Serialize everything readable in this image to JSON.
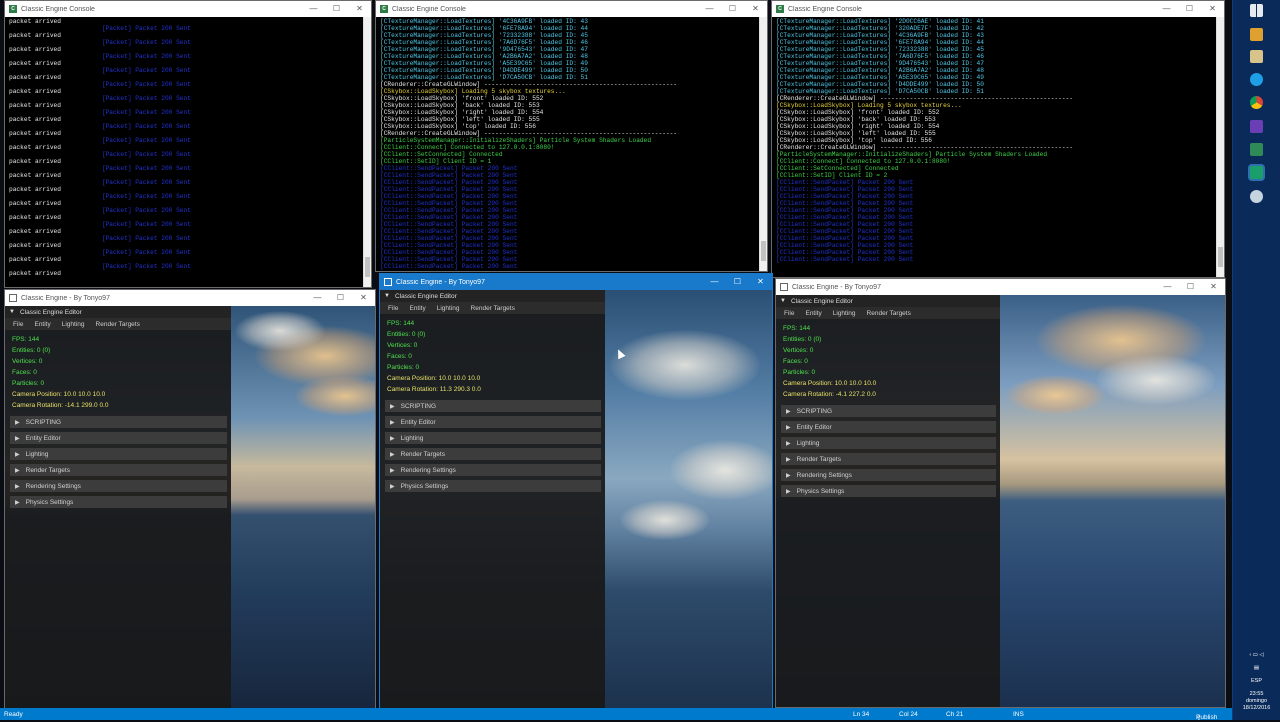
{
  "windows": {
    "console_title": "Classic Engine Console",
    "editor_title": "Classic Engine - By Tonyo97",
    "controls": {
      "minimize": "—",
      "maximize": "☐",
      "close": "✕"
    }
  },
  "console_server": {
    "lines": [
      {
        "t": "packet arrived",
        "c": "white"
      },
      {
        "t": "                         [Packet] Packet 200 Sent",
        "c": "blue"
      },
      {
        "t": "packet arrived",
        "c": "white"
      },
      {
        "t": "                         [Packet] Packet 200 Sent",
        "c": "blue"
      },
      {
        "t": "packet arrived",
        "c": "white"
      },
      {
        "t": "                         [Packet] Packet 200 Sent",
        "c": "blue"
      },
      {
        "t": "packet arrived",
        "c": "white"
      },
      {
        "t": "                         [Packet] Packet 200 Sent",
        "c": "blue"
      },
      {
        "t": "packet arrived",
        "c": "white"
      },
      {
        "t": "                         [Packet] Packet 200 Sent",
        "c": "blue"
      },
      {
        "t": "packet arrived",
        "c": "white"
      },
      {
        "t": "                         [Packet] Packet 200 Sent",
        "c": "blue"
      },
      {
        "t": "packet arrived",
        "c": "white"
      },
      {
        "t": "                         [Packet] Packet 200 Sent",
        "c": "blue"
      },
      {
        "t": "packet arrived",
        "c": "white"
      },
      {
        "t": "                         [Packet] Packet 200 Sent",
        "c": "blue"
      },
      {
        "t": "packet arrived",
        "c": "white"
      },
      {
        "t": "                         [Packet] Packet 200 Sent",
        "c": "blue"
      },
      {
        "t": "packet arrived",
        "c": "white"
      },
      {
        "t": "                         [Packet] Packet 200 Sent",
        "c": "blue"
      },
      {
        "t": "packet arrived",
        "c": "white"
      },
      {
        "t": "                         [Packet] Packet 200 Sent",
        "c": "blue"
      },
      {
        "t": "packet arrived",
        "c": "white"
      },
      {
        "t": "                         [Packet] Packet 200 Sent",
        "c": "blue"
      },
      {
        "t": "packet arrived",
        "c": "white"
      },
      {
        "t": "                         [Packet] Packet 200 Sent",
        "c": "blue"
      },
      {
        "t": "packet arrived",
        "c": "white"
      },
      {
        "t": "                         [Packet] Packet 200 Sent",
        "c": "blue"
      },
      {
        "t": "packet arrived",
        "c": "white"
      },
      {
        "t": "                         [Packet] Packet 200 Sent",
        "c": "blue"
      },
      {
        "t": "packet arrived",
        "c": "white"
      },
      {
        "t": "                         [Packet] Packet 200 Sent",
        "c": "blue"
      },
      {
        "t": "packet arrived",
        "c": "white"
      },
      {
        "t": "                         [Packet] Packet 200 Sent",
        "c": "blue"
      },
      {
        "t": "packet arrived",
        "c": "white"
      },
      {
        "t": "                         [Packet] Packet 200 Sent",
        "c": "blue"
      },
      {
        "t": "packet arrived",
        "c": "white"
      }
    ]
  },
  "console_client1": {
    "lines": [
      {
        "t": "[CTextureManager::LoadTextures] '4C36A9FB' loaded ID: 43",
        "c": "cyan"
      },
      {
        "t": "[CTextureManager::LoadTextures] '6FE78A94' loaded ID: 44",
        "c": "cyan"
      },
      {
        "t": "[CTextureManager::LoadTextures] '72332388' loaded ID: 45",
        "c": "cyan"
      },
      {
        "t": "[CTextureManager::LoadTextures] '7A6D76F5' loaded ID: 46",
        "c": "cyan"
      },
      {
        "t": "[CTextureManager::LoadTextures] '9D476543' loaded ID: 47",
        "c": "cyan"
      },
      {
        "t": "[CTextureManager::LoadTextures] 'A2B6A7A2' loaded ID: 48",
        "c": "cyan"
      },
      {
        "t": "[CTextureManager::LoadTextures] 'A5E39C65' loaded ID: 49",
        "c": "cyan"
      },
      {
        "t": "[CTextureManager::LoadTextures] 'D4DDE499' loaded ID: 50",
        "c": "cyan"
      },
      {
        "t": "[CTextureManager::LoadTextures] 'D7CA50CB' loaded ID: 51",
        "c": "cyan"
      },
      {
        "t": "[CRenderer::CreateGLWindow] ----------------------------------------------------",
        "c": "white"
      },
      {
        "t": "[CSkybox::LoadSkybox] Loading 5 skybox textures...",
        "c": "yellow"
      },
      {
        "t": "[CSkybox::LoadSkybox] 'front' loaded ID: 552",
        "c": "white"
      },
      {
        "t": "[CSkybox::LoadSkybox] 'back' loaded ID: 553",
        "c": "white"
      },
      {
        "t": "[CSkybox::LoadSkybox] 'right' loaded ID: 554",
        "c": "white"
      },
      {
        "t": "[CSkybox::LoadSkybox] 'left' loaded ID: 555",
        "c": "white"
      },
      {
        "t": "[CSkybox::LoadSkybox] 'top' loaded ID: 556",
        "c": "white"
      },
      {
        "t": "[CRenderer::CreateGLWindow] ----------------------------------------------------",
        "c": "white"
      },
      {
        "t": "[ParticleSystemManager::InitializeShaders] Particle System Shaders Loaded",
        "c": "green"
      },
      {
        "t": "[CClient::Connect] Connected to 127.0.0.1:8080!",
        "c": "green"
      },
      {
        "t": "[CClient::SetConnected] Connected",
        "c": "green"
      },
      {
        "t": "[CClient::SetID] Client ID = 1",
        "c": "green"
      },
      {
        "t": "[CClient::SendPacket] Packet 200 Sent",
        "c": "blue"
      },
      {
        "t": "[CClient::SendPacket] Packet 200 Sent",
        "c": "blue"
      },
      {
        "t": "[CClient::SendPacket] Packet 200 Sent",
        "c": "blue"
      },
      {
        "t": "[CClient::SendPacket] Packet 200 Sent",
        "c": "blue"
      },
      {
        "t": "[CClient::SendPacket] Packet 200 Sent",
        "c": "blue"
      },
      {
        "t": "[CClient::SendPacket] Packet 200 Sent",
        "c": "blue"
      },
      {
        "t": "[CClient::SendPacket] Packet 200 Sent",
        "c": "blue"
      },
      {
        "t": "[CClient::SendPacket] Packet 200 Sent",
        "c": "blue"
      },
      {
        "t": "[CClient::SendPacket] Packet 200 Sent",
        "c": "blue"
      },
      {
        "t": "[CClient::SendPacket] Packet 200 Sent",
        "c": "blue"
      },
      {
        "t": "[CClient::SendPacket] Packet 200 Sent",
        "c": "blue"
      },
      {
        "t": "[CClient::SendPacket] Packet 200 Sent",
        "c": "blue"
      },
      {
        "t": "[CClient::SendPacket] Packet 200 Sent",
        "c": "blue"
      },
      {
        "t": "[CClient::SendPacket] Packet 200 Sent",
        "c": "blue"
      },
      {
        "t": "[CClient::SendPacket] Packet 200 Sent",
        "c": "blue"
      }
    ]
  },
  "console_client2": {
    "lines": [
      {
        "t": "[CTextureManager::LoadTextures] '2D0CC6AE' loaded ID: 41",
        "c": "cyan"
      },
      {
        "t": "[CTextureManager::LoadTextures] '320ADE7F' loaded ID: 42",
        "c": "cyan"
      },
      {
        "t": "[CTextureManager::LoadTextures] '4C36A9FB' loaded ID: 43",
        "c": "cyan"
      },
      {
        "t": "[CTextureManager::LoadTextures] '6FE78A94' loaded ID: 44",
        "c": "cyan"
      },
      {
        "t": "[CTextureManager::LoadTextures] '72332388' loaded ID: 45",
        "c": "cyan"
      },
      {
        "t": "[CTextureManager::LoadTextures] '7A6D76F5' loaded ID: 46",
        "c": "cyan"
      },
      {
        "t": "[CTextureManager::LoadTextures] '9D476543' loaded ID: 47",
        "c": "cyan"
      },
      {
        "t": "[CTextureManager::LoadTextures] 'A2B6A7A2' loaded ID: 48",
        "c": "cyan"
      },
      {
        "t": "[CTextureManager::LoadTextures] 'A5E39C65' loaded ID: 49",
        "c": "cyan"
      },
      {
        "t": "[CTextureManager::LoadTextures] 'D4DDE499' loaded ID: 50",
        "c": "cyan"
      },
      {
        "t": "[CTextureManager::LoadTextures] 'D7CA50CB' loaded ID: 51",
        "c": "cyan"
      },
      {
        "t": "[CRenderer::CreateGLWindow] ----------------------------------------------------",
        "c": "white"
      },
      {
        "t": "[CSkybox::LoadSkybox] Loading 5 skybox textures...",
        "c": "yellow"
      },
      {
        "t": "[CSkybox::LoadSkybox] 'front' loaded ID: 552",
        "c": "white"
      },
      {
        "t": "[CSkybox::LoadSkybox] 'back' loaded ID: 553",
        "c": "white"
      },
      {
        "t": "[CSkybox::LoadSkybox] 'right' loaded ID: 554",
        "c": "white"
      },
      {
        "t": "[CSkybox::LoadSkybox] 'left' loaded ID: 555",
        "c": "white"
      },
      {
        "t": "[CSkybox::LoadSkybox] 'top' loaded ID: 556",
        "c": "white"
      },
      {
        "t": "[CRenderer::CreateGLWindow] ----------------------------------------------------",
        "c": "white"
      },
      {
        "t": "[ParticleSystemManager::InitializeShaders] Particle System Shaders Loaded",
        "c": "green"
      },
      {
        "t": "[CClient::Connect] Connected to 127.0.0.1:8080!",
        "c": "green"
      },
      {
        "t": "[CClient::SetConnected] Connected",
        "c": "green"
      },
      {
        "t": "[CClient::SetID] Client ID = 2",
        "c": "green"
      },
      {
        "t": "[CClient::SendPacket] Packet 200 Sent",
        "c": "blue"
      },
      {
        "t": "[CClient::SendPacket] Packet 200 Sent",
        "c": "blue"
      },
      {
        "t": "[CClient::SendPacket] Packet 200 Sent",
        "c": "blue"
      },
      {
        "t": "[CClient::SendPacket] Packet 200 Sent",
        "c": "blue"
      },
      {
        "t": "[CClient::SendPacket] Packet 200 Sent",
        "c": "blue"
      },
      {
        "t": "[CClient::SendPacket] Packet 200 Sent",
        "c": "blue"
      },
      {
        "t": "[CClient::SendPacket] Packet 200 Sent",
        "c": "blue"
      },
      {
        "t": "[CClient::SendPacket] Packet 200 Sent",
        "c": "blue"
      },
      {
        "t": "[CClient::SendPacket] Packet 200 Sent",
        "c": "blue"
      },
      {
        "t": "[CClient::SendPacket] Packet 200 Sent",
        "c": "blue"
      },
      {
        "t": "[CClient::SendPacket] Packet 200 Sent",
        "c": "blue"
      },
      {
        "t": "[CClient::SendPacket] Packet 200 Sent",
        "c": "blue"
      }
    ]
  },
  "editor": {
    "panel_title": "Classic Engine Editor",
    "menu": [
      "File",
      "Entity",
      "Lighting",
      "Render Targets"
    ],
    "sections": [
      "SCRIPTING",
      "Entity Editor",
      "Lighting",
      "Render Targets",
      "Rendering Settings",
      "Physics Settings"
    ]
  },
  "editor_left": {
    "stats": [
      {
        "t": "FPS: 144",
        "c": "green"
      },
      {
        "t": "Entities: 0 (0)",
        "c": "green"
      },
      {
        "t": "Vertices: 0",
        "c": "green"
      },
      {
        "t": "Faces: 0",
        "c": "green"
      },
      {
        "t": "Particles: 0",
        "c": "green"
      },
      {
        "t": "Camera Position: 10.0 10.0 10.0",
        "c": "yellow"
      },
      {
        "t": "Camera Rotation: -14.1 299.0 0.0",
        "c": "yellow"
      }
    ]
  },
  "editor_mid": {
    "stats": [
      {
        "t": "FPS: 144",
        "c": "green"
      },
      {
        "t": "Entities: 0 (0)",
        "c": "green"
      },
      {
        "t": "Vertices: 0",
        "c": "green"
      },
      {
        "t": "Faces: 0",
        "c": "green"
      },
      {
        "t": "Particles: 0",
        "c": "green"
      },
      {
        "t": "Camera Position: 10.0 10.0 10.0",
        "c": "yellow"
      },
      {
        "t": "Camera Rotation: 11.3 290.3 0.0",
        "c": "yellow"
      }
    ]
  },
  "editor_right": {
    "stats": [
      {
        "t": "FPS: 144",
        "c": "green"
      },
      {
        "t": "Entities: 0 (0)",
        "c": "green"
      },
      {
        "t": "Vertices: 0",
        "c": "green"
      },
      {
        "t": "Faces: 0",
        "c": "green"
      },
      {
        "t": "Particles: 0",
        "c": "green"
      },
      {
        "t": "Camera Position: 10.0 10.0 10.0",
        "c": "yellow"
      },
      {
        "t": "Camera Rotation: -4.1 227.2 0.0",
        "c": "yellow"
      }
    ]
  },
  "statusbar": {
    "ready": "Ready",
    "ln": "Ln 34",
    "col": "Col 24",
    "ch": "Ch 21",
    "ins": "INS",
    "publish": "Publish"
  },
  "tray": {
    "lang": "ESP",
    "time": "23:55",
    "day": "domingo",
    "date": "18/12/2016"
  },
  "colors": {
    "accent": "#1979ca",
    "statusbar": "#007acc",
    "taskbar": "#0a2b5a"
  }
}
